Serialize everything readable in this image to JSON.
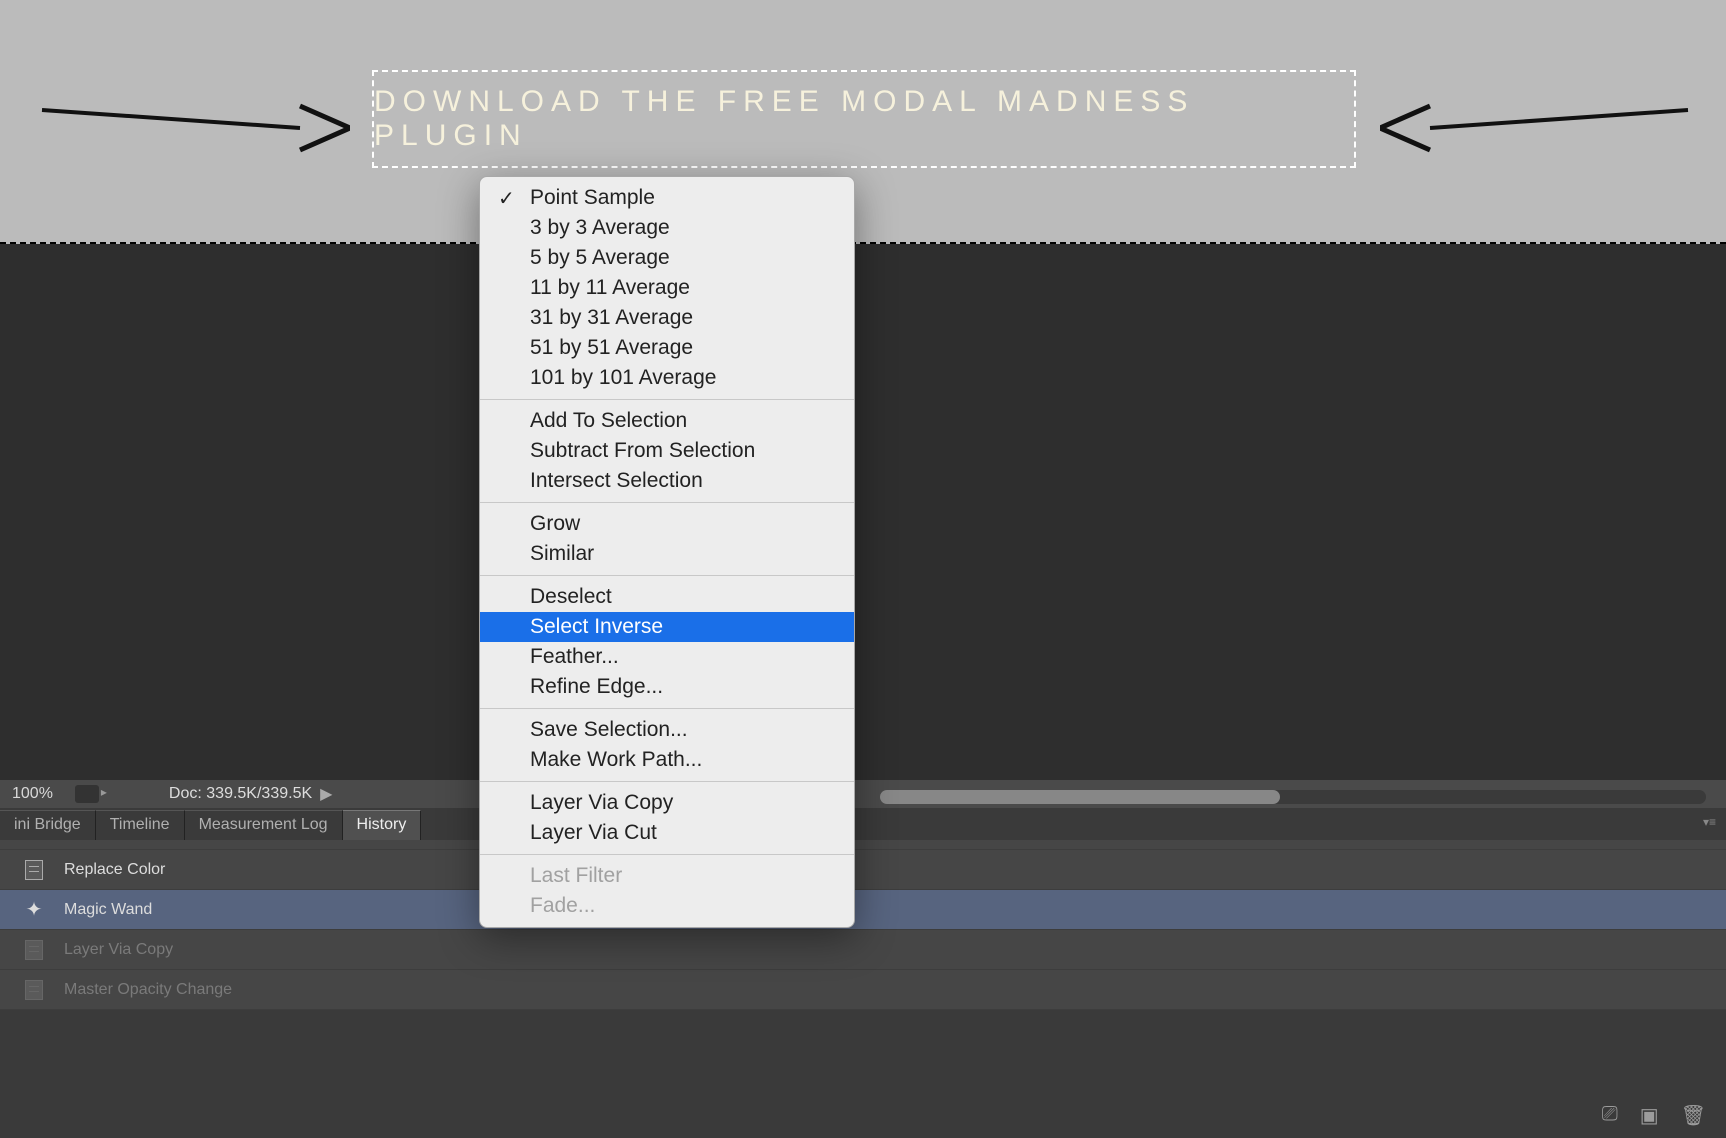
{
  "banner": {
    "button_label": "DOWNLOAD THE FREE MODAL MADNESS PLUGIN"
  },
  "status": {
    "zoom": "100%",
    "doc": "Doc: 339.5K/339.5K"
  },
  "tabs": [
    "ini Bridge",
    "Timeline",
    "Measurement Log",
    "History"
  ],
  "active_tab": 3,
  "history": [
    {
      "label": "Replace Color",
      "icon": "page",
      "dim": false,
      "sel": false
    },
    {
      "label": "Magic Wand",
      "icon": "wand",
      "dim": false,
      "sel": true
    },
    {
      "label": "Layer Via Copy",
      "icon": "page",
      "dim": true,
      "sel": false
    },
    {
      "label": "Master Opacity Change",
      "icon": "page",
      "dim": true,
      "sel": false
    }
  ],
  "menu": [
    {
      "label": "Point Sample",
      "checked": true
    },
    {
      "label": "3 by 3 Average"
    },
    {
      "label": "5 by 5 Average"
    },
    {
      "label": "11 by 11 Average"
    },
    {
      "label": "31 by 31 Average"
    },
    {
      "label": "51 by 51 Average"
    },
    {
      "label": "101 by 101 Average"
    },
    {
      "sep": true
    },
    {
      "label": "Add To Selection"
    },
    {
      "label": "Subtract From Selection"
    },
    {
      "label": "Intersect Selection"
    },
    {
      "sep": true
    },
    {
      "label": "Grow"
    },
    {
      "label": "Similar"
    },
    {
      "sep": true
    },
    {
      "label": "Deselect"
    },
    {
      "label": "Select Inverse",
      "highlight": true
    },
    {
      "label": "Feather..."
    },
    {
      "label": "Refine Edge..."
    },
    {
      "sep": true
    },
    {
      "label": "Save Selection..."
    },
    {
      "label": "Make Work Path..."
    },
    {
      "sep": true
    },
    {
      "label": "Layer Via Copy"
    },
    {
      "label": "Layer Via Cut"
    },
    {
      "sep": true
    },
    {
      "label": "Last Filter",
      "disabled": true
    },
    {
      "label": "Fade...",
      "disabled": true
    }
  ]
}
